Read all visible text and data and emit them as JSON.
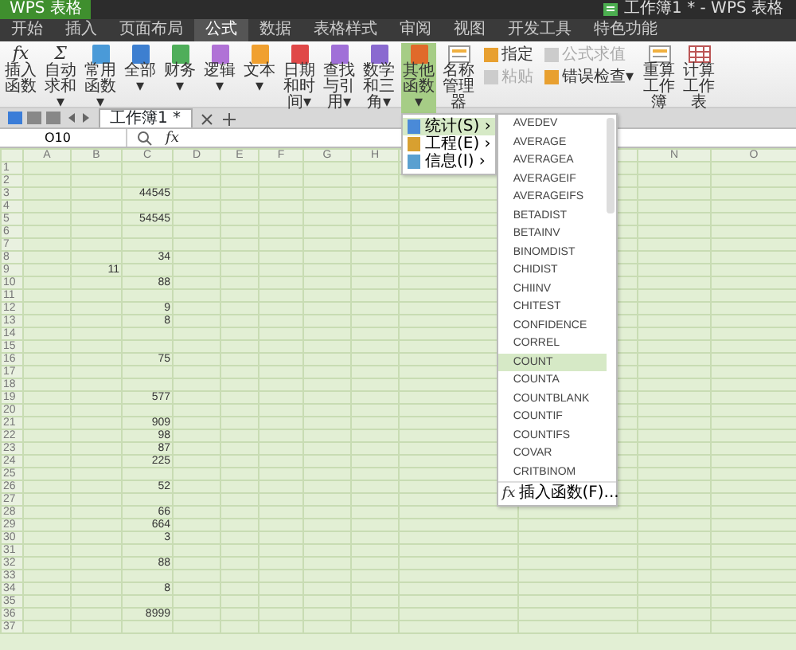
{
  "app_button": "WPS 表格",
  "window_title": "工作簿1 * - WPS 表格",
  "menu_tabs": [
    {
      "label": "开始",
      "selected": false
    },
    {
      "label": "插入",
      "selected": false
    },
    {
      "label": "页面布局",
      "selected": false
    },
    {
      "label": "公式",
      "selected": true
    },
    {
      "label": "数据",
      "selected": false
    },
    {
      "label": "表格样式",
      "selected": false
    },
    {
      "label": "审阅",
      "selected": false
    },
    {
      "label": "视图",
      "selected": false
    },
    {
      "label": "开发工具",
      "selected": false
    },
    {
      "label": "特色功能",
      "selected": false
    }
  ],
  "ribbon": [
    {
      "kind": "glyph",
      "glyph": "fx",
      "label": "插入函数",
      "selected": false
    },
    {
      "kind": "glyph",
      "glyph": "Σ",
      "label": "自动求和▾",
      "selected": false
    },
    {
      "kind": "book",
      "color": "#4a9ad8",
      "label": "常用函数▾",
      "selected": false
    },
    {
      "kind": "book",
      "color": "#3d7fd0",
      "label": "全部▾",
      "selected": false
    },
    {
      "kind": "book",
      "color": "#4fae5a",
      "label": "财务▾",
      "selected": false
    },
    {
      "kind": "book",
      "color": "#b072d6",
      "label": "逻辑▾",
      "selected": false
    },
    {
      "kind": "book",
      "color": "#f0a030",
      "label": "文本▾",
      "selected": false
    },
    {
      "kind": "book",
      "color": "#e04848",
      "label": "日期和时间▾",
      "selected": false
    },
    {
      "kind": "book",
      "color": "#a070d8",
      "label": "查找与引用▾",
      "selected": false
    },
    {
      "kind": "book",
      "color": "#8a6ad0",
      "label": "数学和三角▾",
      "selected": false
    },
    {
      "kind": "book",
      "color": "#e06a2a",
      "label": "其他函数▾",
      "selected": true
    },
    {
      "kind": "sheet",
      "label": "名称管理器",
      "selected": false
    },
    {
      "kind": "stack",
      "items": [
        {
          "label": "指定",
          "disabled": false
        },
        {
          "label": "粘贴",
          "disabled": true
        }
      ]
    },
    {
      "kind": "stack",
      "items": [
        {
          "label": "公式求值",
          "disabled": true
        },
        {
          "label": "错误检查▾",
          "disabled": false
        }
      ]
    },
    {
      "kind": "sheet",
      "label": "重算工作簿",
      "selected": false
    },
    {
      "kind": "grid",
      "label": "计算工作表",
      "selected": false
    }
  ],
  "document_tab": "工作簿1 *",
  "name_box": "O10",
  "formula_bar_glyph": "fx",
  "columns_left": [
    "A",
    "B",
    "C",
    "D",
    "E",
    "F",
    "G",
    "H"
  ],
  "columns_right": [
    "N",
    "O"
  ],
  "rows": [
    {
      "number": "1"
    },
    {
      "number": "2"
    },
    {
      "number": "3",
      "C": "44545"
    },
    {
      "number": "4"
    },
    {
      "number": "5",
      "C": "54545"
    },
    {
      "number": "6"
    },
    {
      "number": "7"
    },
    {
      "number": "8",
      "C": "34"
    },
    {
      "number": "9",
      "B": "11"
    },
    {
      "number": "10",
      "C": "88"
    },
    {
      "number": "11"
    },
    {
      "number": "12",
      "C": "9"
    },
    {
      "number": "13",
      "C": "8"
    },
    {
      "number": "14"
    },
    {
      "number": "15"
    },
    {
      "number": "16",
      "C": "75"
    },
    {
      "number": "17"
    },
    {
      "number": "18"
    },
    {
      "number": "19",
      "C": "577"
    },
    {
      "number": "20"
    },
    {
      "number": "21",
      "C": "909"
    },
    {
      "number": "22",
      "C": "98"
    },
    {
      "number": "23",
      "C": "87"
    },
    {
      "number": "24",
      "C": "225"
    },
    {
      "number": "25"
    },
    {
      "number": "26",
      "C": "52"
    },
    {
      "number": "27"
    },
    {
      "number": "28",
      "C": "66"
    },
    {
      "number": "29",
      "C": "664"
    },
    {
      "number": "30",
      "C": "3"
    },
    {
      "number": "31"
    },
    {
      "number": "32",
      "C": "88"
    },
    {
      "number": "33"
    },
    {
      "number": "34",
      "C": "8"
    },
    {
      "number": "35"
    },
    {
      "number": "36",
      "C": "8999"
    },
    {
      "number": "37"
    }
  ],
  "other_functions_menu": {
    "categories": [
      {
        "label": "统计(S)",
        "arrow": "›",
        "selected": true
      },
      {
        "label": "工程(E)",
        "arrow": "›",
        "selected": false
      },
      {
        "label": "信息(I)",
        "arrow": "›",
        "selected": false
      }
    ],
    "functions": [
      {
        "label": "AVEDEV",
        "selected": false
      },
      {
        "label": "AVERAGE",
        "selected": false
      },
      {
        "label": "AVERAGEA",
        "selected": false
      },
      {
        "label": "AVERAGEIF",
        "selected": false
      },
      {
        "label": "AVERAGEIFS",
        "selected": false
      },
      {
        "label": "BETADIST",
        "selected": false
      },
      {
        "label": "BETAINV",
        "selected": false
      },
      {
        "label": "BINOMDIST",
        "selected": false
      },
      {
        "label": "CHIDIST",
        "selected": false
      },
      {
        "label": "CHIINV",
        "selected": false
      },
      {
        "label": "CHITEST",
        "selected": false
      },
      {
        "label": "CONFIDENCE",
        "selected": false
      },
      {
        "label": "CORREL",
        "selected": false
      },
      {
        "label": "COUNT",
        "selected": true
      },
      {
        "label": "COUNTA",
        "selected": false
      },
      {
        "label": "COUNTBLANK",
        "selected": false
      },
      {
        "label": "COUNTIF",
        "selected": false
      },
      {
        "label": "COUNTIFS",
        "selected": false
      },
      {
        "label": "COVAR",
        "selected": false
      },
      {
        "label": "CRITBINOM",
        "selected": false
      }
    ],
    "footer_glyph": "fx",
    "footer": "插入函数(F)..."
  }
}
